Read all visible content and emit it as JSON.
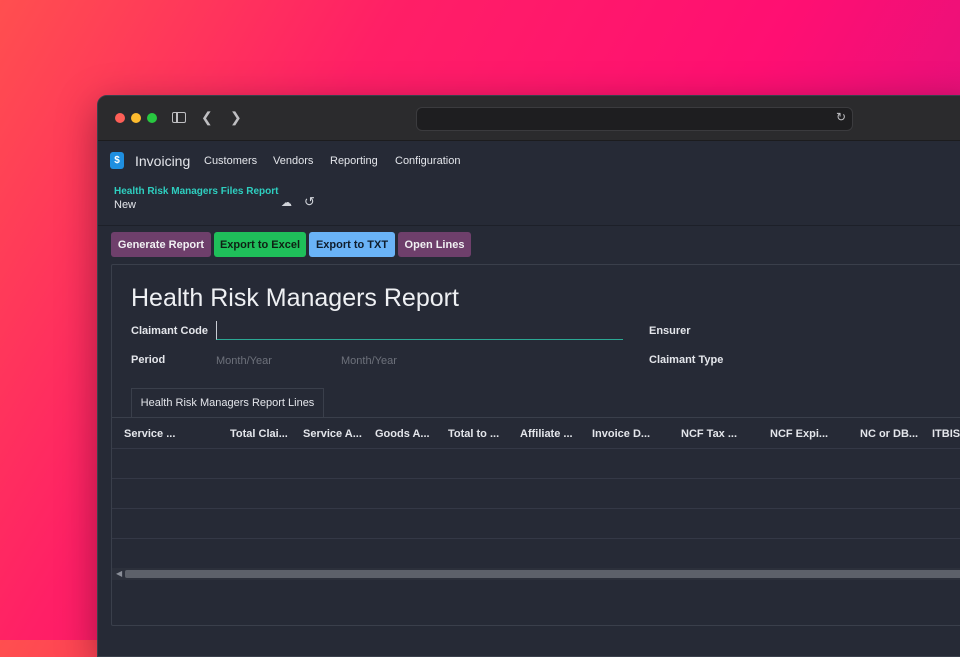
{
  "browser": {
    "address": "",
    "icons": {
      "sidebar": "sidebar-toggle-icon",
      "back": "chevron-left-icon",
      "forward": "chevron-right-icon",
      "reload": "reload-icon"
    }
  },
  "app": {
    "name": "Invoicing",
    "logo_glyph": "$",
    "accent": "#1f8fe0"
  },
  "nav": {
    "items": [
      "Customers",
      "Vendors",
      "Reporting",
      "Configuration"
    ]
  },
  "breadcrumb": {
    "parent": "Health Risk Managers Files Report",
    "current": "New"
  },
  "actions": {
    "generate": "Generate Report",
    "excel": "Export to Excel",
    "txt": "Export to TXT",
    "open_lines": "Open Lines"
  },
  "form": {
    "title": "Health Risk Managers Report",
    "claimant_code_label": "Claimant Code",
    "claimant_code_value": "",
    "period_label": "Period",
    "period_from_placeholder": "Month/Year",
    "period_to_placeholder": "Month/Year",
    "ensurer_label": "Ensurer",
    "claimant_type_label": "Claimant Type"
  },
  "tab": {
    "label": "Health Risk Managers Report Lines"
  },
  "table": {
    "columns": [
      "Service ...",
      "Total Clai...",
      "Service A...",
      "Goods A...",
      "Total to ...",
      "Affiliate ...",
      "Invoice D...",
      "NCF Tax ...",
      "NCF Expi...",
      "NC or DB...",
      "ITBIS ..."
    ],
    "rows": []
  },
  "colors": {
    "generate_bg": "#6e3f6b",
    "excel_bg": "#1fbf5a",
    "txt_bg": "#6ab3f7",
    "link": "#2ecfc0"
  }
}
